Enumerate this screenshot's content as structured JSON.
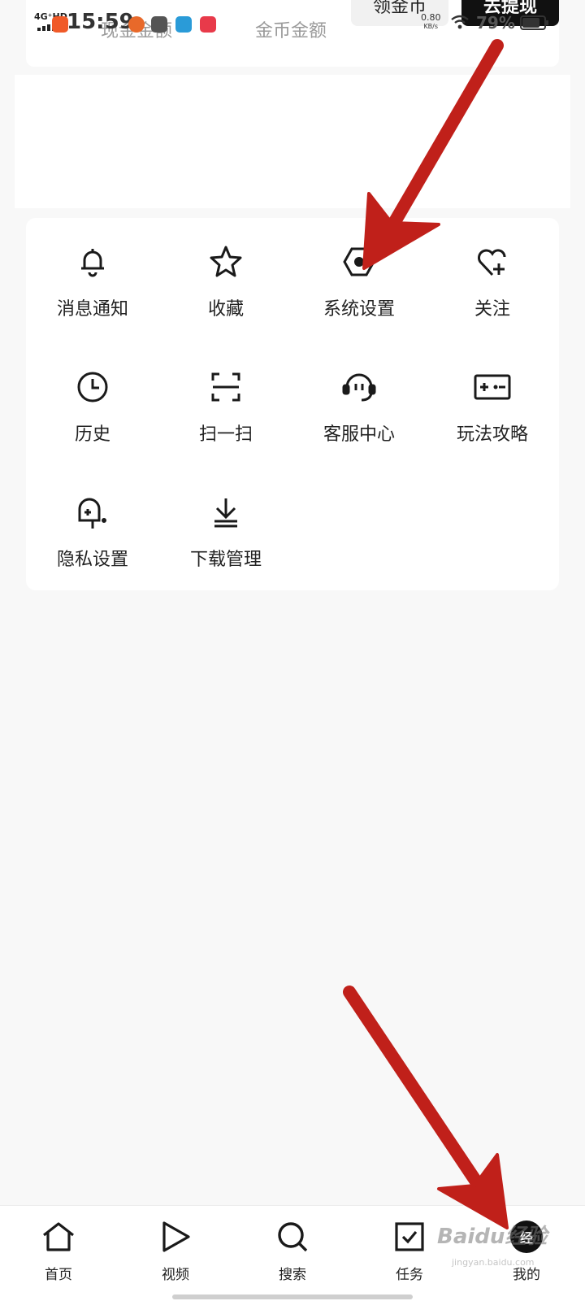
{
  "status_bar": {
    "network": "4G⁺HD",
    "time": "15:59",
    "speed_value": "0.80",
    "speed_unit": "KB/s",
    "battery_percent": "79%",
    "battery_level": 0.79
  },
  "coins": {
    "cash_label": "现金金额",
    "gold_label": "金币金额",
    "get_coins_button": "领金币",
    "withdraw_button": "去提现"
  },
  "menu": {
    "items": [
      {
        "label": "消息通知",
        "icon": "bell-icon"
      },
      {
        "label": "收藏",
        "icon": "star-icon"
      },
      {
        "label": "系统设置",
        "icon": "settings-icon"
      },
      {
        "label": "关注",
        "icon": "heart-plus-icon"
      },
      {
        "label": "历史",
        "icon": "clock-icon"
      },
      {
        "label": "扫一扫",
        "icon": "scan-icon"
      },
      {
        "label": "客服中心",
        "icon": "headset-icon"
      },
      {
        "label": "玩法攻略",
        "icon": "game-guide-icon"
      },
      {
        "label": "隐私设置",
        "icon": "privacy-mailbox-icon"
      },
      {
        "label": "下载管理",
        "icon": "download-icon"
      }
    ]
  },
  "bottom_nav": {
    "items": [
      {
        "label": "首页",
        "icon": "home-icon"
      },
      {
        "label": "视频",
        "icon": "play-icon"
      },
      {
        "label": "搜索",
        "icon": "search-icon"
      },
      {
        "label": "任务",
        "icon": "task-check-icon"
      },
      {
        "label": "我的",
        "icon": "avatar-icon"
      }
    ],
    "avatar_text": "经"
  },
  "watermark": {
    "text": "Baidu经验",
    "sub": "jingyan.baidu.com"
  },
  "colors": {
    "annotation_arrow": "#c0201a",
    "background": "#f8f8f8",
    "card": "#ffffff",
    "dark_button": "#111111"
  }
}
